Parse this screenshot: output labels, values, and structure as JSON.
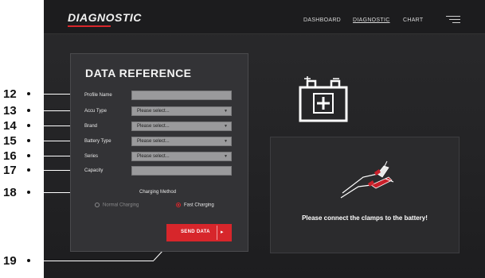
{
  "header": {
    "brand": "DIAGNOSTIC",
    "nav": [
      {
        "label": "DASHBOARD",
        "active": false
      },
      {
        "label": "DIAGNOSTIC",
        "active": true
      },
      {
        "label": "CHART",
        "active": false
      }
    ]
  },
  "form": {
    "title": "DATA REFERENCE",
    "fields": [
      {
        "label": "Profile Name",
        "type": "text",
        "value": ""
      },
      {
        "label": "Accu Type",
        "type": "select",
        "value": "Please select..."
      },
      {
        "label": "Brand",
        "type": "select",
        "value": "Please select..."
      },
      {
        "label": "Battery Type",
        "type": "select",
        "value": "Please select..."
      },
      {
        "label": "Series",
        "type": "select",
        "value": "Please select..."
      },
      {
        "label": "Capacity",
        "type": "text",
        "value": ""
      }
    ],
    "charging_method_label": "Charging Method",
    "options": [
      {
        "label": "Normal Charging",
        "selected": false
      },
      {
        "label": "Fast Charging",
        "selected": true
      }
    ],
    "send_label": "SEND DATA",
    "send_arrow": "▸"
  },
  "status": {
    "message": "Please connect the clamps to the battery!"
  },
  "callouts": [
    "12",
    "13",
    "14",
    "15",
    "16",
    "17",
    "18",
    "19"
  ],
  "colors": {
    "accent": "#d7262b",
    "background": "#262628",
    "panel": "#333336"
  }
}
